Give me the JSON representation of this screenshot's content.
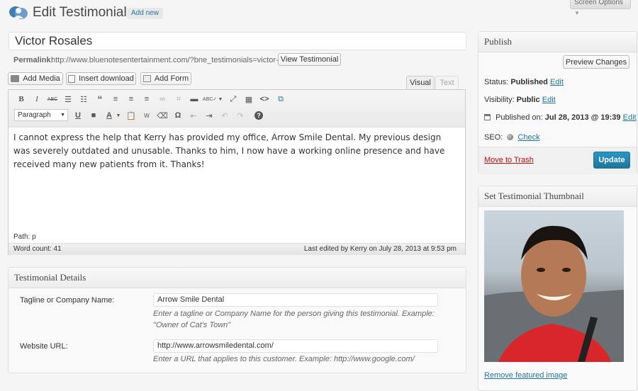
{
  "header": {
    "title": "Edit Testimonial",
    "add_new": "Add new",
    "screen_options": "Screen Options"
  },
  "post": {
    "title_value": "Victor Rosales",
    "permalink_label": "Permalink:",
    "permalink_url": "http://www.bluenotesentertainment.com/?bne_testimonials=victor-rosales",
    "view_button": "View Testimonial"
  },
  "media_buttons": {
    "add_media": "Add Media",
    "insert_download": "Insert download",
    "add_form": "Add Form"
  },
  "editor": {
    "tab_visual": "Visual",
    "tab_text": "Text",
    "format_select": "Paragraph",
    "content": "I cannot express the help that Kerry has provided my office, Arrow Smile Dental. My previous design was severely outdated and unusable. Thanks to him, I now have a working online presence and have received many new patients from it. Thanks!",
    "path": "Path: p",
    "word_count": "Word count: 41",
    "last_edited": "Last edited by Kerry on July 28, 2013 at 9:53 pm"
  },
  "details": {
    "title": "Testimonial Details",
    "tagline_label": "Tagline or Company Name:",
    "tagline_value": "Arrow Smile Dental",
    "tagline_hint": "Enter a tagline or Company Name for the person giving this testimonial. Example: \"Owner of Cat's Town\"",
    "url_label": "Website URL:",
    "url_value": "http://www.arrowsmiledental.com/",
    "url_hint": "Enter a URL that applies to this customer. Example: http://www.google.com/"
  },
  "publish": {
    "title": "Publish",
    "preview": "Preview Changes",
    "status_label": "Status:",
    "status_value": "Published",
    "visibility_label": "Visibility:",
    "visibility_value": "Public",
    "published_label": "Published on:",
    "published_value": "Jul 28, 2013 @ 19:39",
    "edit": "Edit",
    "seo_label": "SEO:",
    "seo_check": "Check",
    "trash": "Move to Trash",
    "update": "Update"
  },
  "thumbnail": {
    "title": "Set Testimonial Thumbnail",
    "remove": "Remove featured image"
  },
  "colors": {
    "link": "#21759b",
    "primary": "#21759b",
    "trash": "#bc0b0b"
  }
}
